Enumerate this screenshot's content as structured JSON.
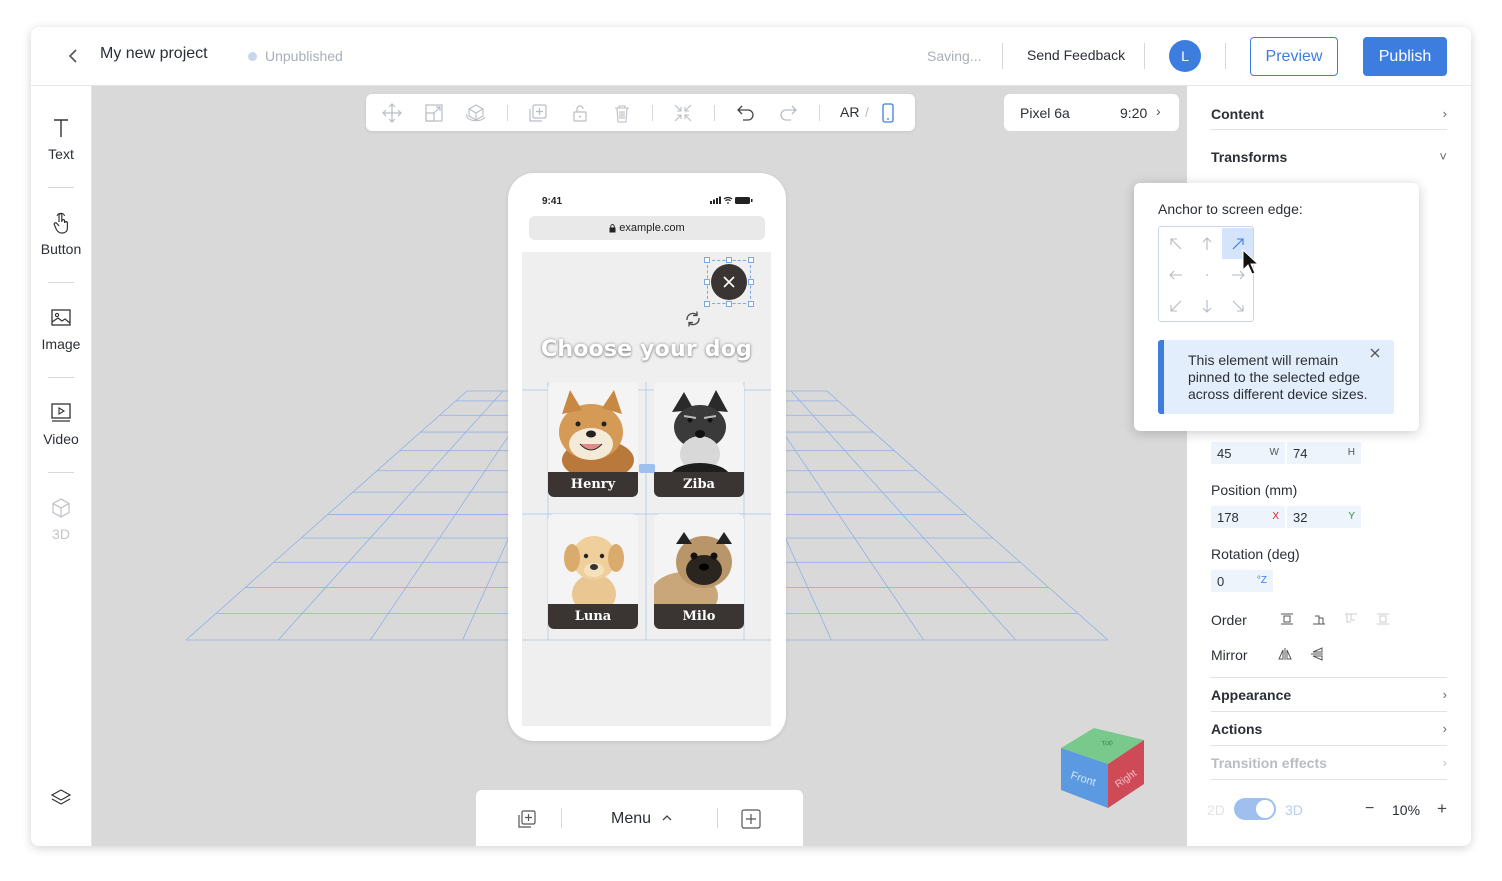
{
  "header": {
    "back_icon": "chevron-left-icon",
    "project_title": "My new project",
    "status": "Unpublished",
    "saving": "Saving...",
    "feedback": "Send Feedback",
    "avatar_initial": "L",
    "preview": "Preview",
    "publish": "Publish"
  },
  "tools": [
    {
      "label": "Text",
      "icon": "text-icon"
    },
    {
      "label": "Button",
      "icon": "pointer-hand-icon"
    },
    {
      "label": "Image",
      "icon": "image-icon"
    },
    {
      "label": "Video",
      "icon": "video-icon"
    },
    {
      "label": "3D",
      "icon": "cube-icon",
      "disabled": true
    }
  ],
  "toolbar": {
    "ar": "AR",
    "slash": "/",
    "icons": [
      "move-icon",
      "scale-icon",
      "rotate-3d-icon",
      "duplicate-icon",
      "lock-icon",
      "trash-icon",
      "collapse-icon",
      "undo-icon",
      "redo-icon",
      "phone-icon"
    ]
  },
  "device": {
    "name": "Pixel 6a",
    "ratio": "9:20",
    "chevron": "›"
  },
  "phone": {
    "time": "9:41",
    "url": "example.com",
    "heading": "Choose your dog",
    "dogs": [
      {
        "name": "Henry"
      },
      {
        "name": "Ziba"
      },
      {
        "name": "Luna"
      },
      {
        "name": "Milo"
      }
    ]
  },
  "bottombar": {
    "menu": "Menu"
  },
  "cube": {
    "front": "Front",
    "right": "Right",
    "top": "Top"
  },
  "panel": {
    "content": "Content",
    "transforms": "Transforms",
    "size": {
      "w": "45",
      "w_unit": "W",
      "h": "74",
      "h_unit": "H"
    },
    "position_label": "Position (mm)",
    "position": {
      "x": "178",
      "x_unit": "X",
      "y": "32",
      "y_unit": "Y"
    },
    "rotation_label": "Rotation (deg)",
    "rotation": {
      "z": "0",
      "z_unit": "°Z"
    },
    "order": "Order",
    "mirror": "Mirror",
    "appearance": "Appearance",
    "actions": "Actions",
    "transition": "Transition effects",
    "mode_2d": "2D",
    "mode_3d": "3D",
    "zoom": "10%",
    "minus": "−",
    "plus": "+",
    "chevron": "›",
    "chevron_down": "˅"
  },
  "popup": {
    "title": "Anchor to screen edge:",
    "info": "This element will remain pinned to the selected edge across different device sizes."
  },
  "colors": {
    "accent": "#3e7de0",
    "canvas": "#d9d9da",
    "grid": "#7aa7e8"
  }
}
